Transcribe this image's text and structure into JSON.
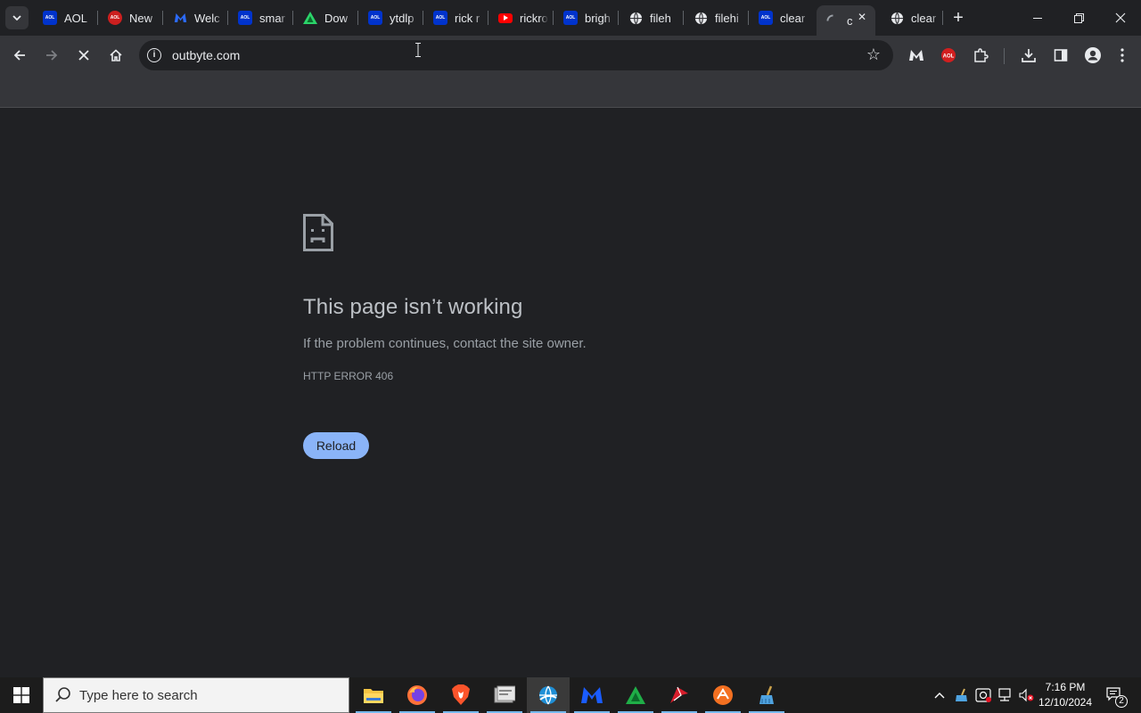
{
  "tabs": [
    {
      "title": "AOL",
      "icon": "aol-icon",
      "color": "#0033cc"
    },
    {
      "title": "New",
      "icon": "aol-red-icon",
      "color": "#cc1f1f"
    },
    {
      "title": "Welc",
      "icon": "malwarebytes-icon",
      "color": "#1a4fd6"
    },
    {
      "title": "smar",
      "icon": "aol-icon",
      "color": "#0033cc"
    },
    {
      "title": "Dow",
      "icon": "triangle-green-icon",
      "color": "#1fae47"
    },
    {
      "title": "ytdlp",
      "icon": "aol-icon",
      "color": "#0033cc"
    },
    {
      "title": "rick r",
      "icon": "aol-icon",
      "color": "#0033cc"
    },
    {
      "title": "rickro",
      "icon": "youtube-icon",
      "color": "#ff0000"
    },
    {
      "title": "brigh",
      "icon": "aol-icon",
      "color": "#0033cc"
    },
    {
      "title": "fileh",
      "icon": "globe-icon",
      "color": "#9aa0a6"
    },
    {
      "title": "filehi",
      "icon": "globe-icon",
      "color": "#9aa0a6"
    },
    {
      "title": "clear",
      "icon": "aol-icon",
      "color": "#0033cc"
    },
    {
      "title": "c",
      "icon": "loading-spinner-icon",
      "color": "#9aa0a6",
      "active": true
    },
    {
      "title": "clear",
      "icon": "globe-icon",
      "color": "#9aa0a6"
    }
  ],
  "address_bar": {
    "url": "outbyte.com"
  },
  "error_page": {
    "title": "This page isn’t working",
    "description": "If the problem continues, contact the site owner.",
    "code": "HTTP ERROR 406",
    "reload_label": "Reload"
  },
  "taskbar": {
    "search_placeholder": "Type here to search",
    "time": "7:16 PM",
    "date": "12/10/2024",
    "notification_count": "2"
  },
  "colors": {
    "accent": "#8ab4f8",
    "page_bg": "#202124",
    "toolbar_bg": "#35363a"
  }
}
